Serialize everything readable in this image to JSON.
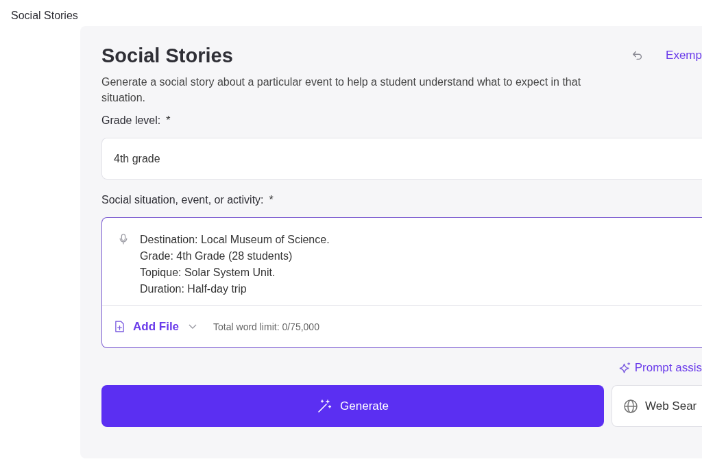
{
  "app_title": "Social Stories",
  "tool": {
    "title": "Social Stories",
    "description": "Generate a social story about a particular event to help a student understand what to expect in that situation.",
    "examples_link": "Exemp"
  },
  "grade_level": {
    "label": "Grade level:",
    "required_mark": "*",
    "value": "4th grade"
  },
  "situation": {
    "label": "Social situation, event, or activity:",
    "required_mark": "*",
    "lines": [
      "Destination: Local Museum of Science.",
      "Grade: 4th Grade (28 students)",
      "Topique: Solar System Unit.",
      "Duration: Half-day trip"
    ],
    "add_file": "Add File",
    "word_limit": "Total word limit: 0/75,000"
  },
  "prompt_assist": "Prompt assis",
  "buttons": {
    "generate": "Generate",
    "web_search": "Web Sear"
  }
}
